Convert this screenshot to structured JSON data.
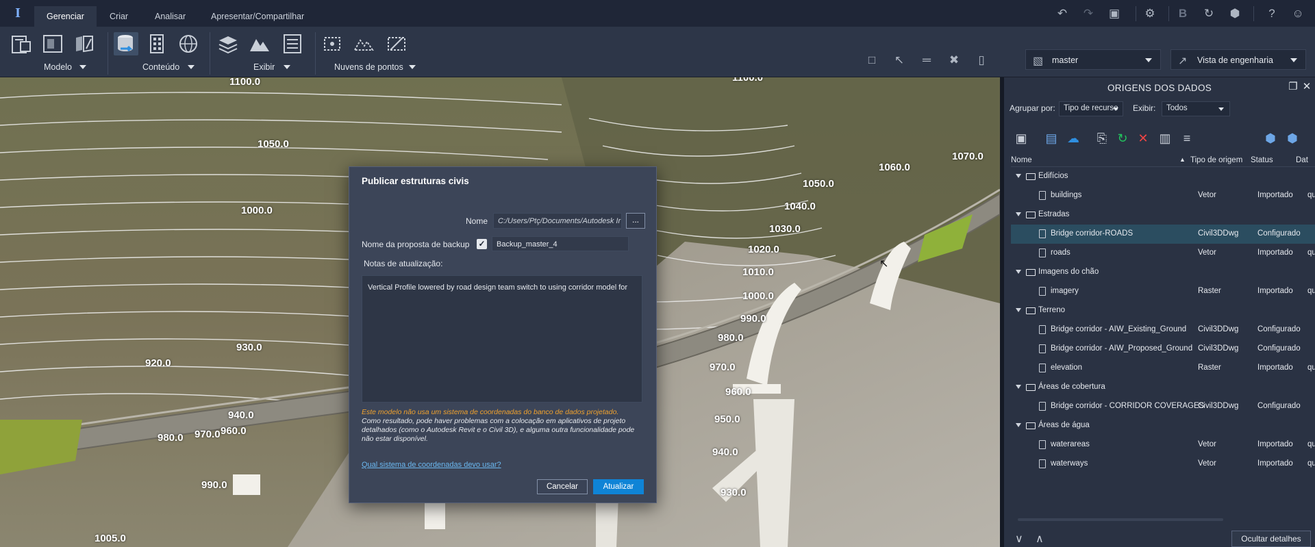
{
  "app": {
    "logo": "I"
  },
  "tabs": [
    "Gerenciar",
    "Criar",
    "Analisar",
    "Apresentar/Compartilhar"
  ],
  "titlebar_icons": [
    "undo-icon",
    "redo-icon",
    "view-icon",
    "settings-icon",
    "bold-b-icon",
    "refresh-icon",
    "cube-icon",
    "help-icon",
    "user-icon"
  ],
  "ribbon": {
    "groups": [
      {
        "label": "Modelo"
      },
      {
        "label": "Conteúdo"
      },
      {
        "label": "Exibir"
      },
      {
        "label": "Nuvens de pontos"
      }
    ]
  },
  "proposal_dropdown": {
    "value": "master"
  },
  "view_dropdown": {
    "value": "Vista de engenharia"
  },
  "contours": [
    "1100.0",
    "1050.0",
    "1000.0",
    "930.0",
    "920.0",
    "940.0",
    "980.0",
    "970.0",
    "960.0",
    "990.0",
    "1005.0",
    "1070.0",
    "1060.0",
    "1050.0",
    "1040.0",
    "1030.0",
    "1020.0",
    "1010.0",
    "1000.0",
    "990.0",
    "980.0",
    "970.0",
    "960.0",
    "950.0",
    "940.0",
    "930.0",
    "1100.0"
  ],
  "panel": {
    "title": "ORIGENS DOS DADOS",
    "group_by_label": "Agrupar por:",
    "group_by_value": "Tipo de recurso",
    "show_label": "Exibir:",
    "show_value": "Todos",
    "columns": {
      "name": "Nome",
      "type": "Tipo de origem",
      "status": "Status",
      "date": "Dat"
    },
    "rows": [
      {
        "kind": "folder",
        "name": "Edifícios"
      },
      {
        "kind": "item",
        "name": "buildings",
        "type": "Vetor",
        "status": "Importado",
        "date": "qua"
      },
      {
        "kind": "folder",
        "name": "Estradas"
      },
      {
        "kind": "item",
        "name": "Bridge corridor-ROADS",
        "type": "Civil3DDwg",
        "status": "Configurado",
        "date": ""
      },
      {
        "kind": "item",
        "name": "roads",
        "type": "Vetor",
        "status": "Importado",
        "date": "qua"
      },
      {
        "kind": "folder",
        "name": "Imagens do chão"
      },
      {
        "kind": "item",
        "name": "imagery",
        "type": "Raster",
        "status": "Importado",
        "date": "qui"
      },
      {
        "kind": "folder",
        "name": "Terreno"
      },
      {
        "kind": "item",
        "name": "Bridge corridor - AIW_Existing_Ground",
        "type": "Civil3DDwg",
        "status": "Configurado",
        "date": ""
      },
      {
        "kind": "item",
        "name": "Bridge corridor - AIW_Proposed_Ground",
        "type": "Civil3DDwg",
        "status": "Configurado",
        "date": ""
      },
      {
        "kind": "item",
        "name": "elevation",
        "type": "Raster",
        "status": "Importado",
        "date": "qua"
      },
      {
        "kind": "folder",
        "name": "Áreas de cobertura"
      },
      {
        "kind": "item",
        "name": "Bridge corridor - CORRIDOR COVERAGES",
        "type": "Civil3DDwg",
        "status": "Configurado",
        "date": ""
      },
      {
        "kind": "folder",
        "name": "Áreas de água"
      },
      {
        "kind": "item",
        "name": "waterareas",
        "type": "Vetor",
        "status": "Importado",
        "date": "qua"
      },
      {
        "kind": "item",
        "name": "waterways",
        "type": "Vetor",
        "status": "Importado",
        "date": "qua"
      }
    ],
    "hide_details": "Ocultar detalhes"
  },
  "dialog": {
    "title": "Publicar estruturas civis",
    "name_label": "Nome",
    "name_value": "C:/Users/Ptç/Documents/Autodesk Ir",
    "browse_label": "...",
    "backup_label": "Nome da proposta de backup",
    "backup_checked": "✓",
    "backup_value": "Backup_master_4",
    "notes_label": "Notas de atualização:",
    "notes_value": "Vertical Profile lowered by road design team switch to using corridor model for",
    "warning_orange": "Este modelo não usa um sistema de coordenadas do banco de dados projetado.",
    "warning_white": "Como resultado, pode haver problemas com a colocação em aplicativos de projeto detalhados (como o Autodesk Revit e o Civil 3D), e alguma outra funcionalidade pode não estar disponível.",
    "link": "Qual sistema de coordenadas devo usar?",
    "cancel": "Cancelar",
    "update": "Atualizar"
  },
  "colors": {
    "accent": "#0f84d6",
    "warning": "#f0a22e",
    "link": "#6bb8f0",
    "selection": "#2b4d60"
  }
}
